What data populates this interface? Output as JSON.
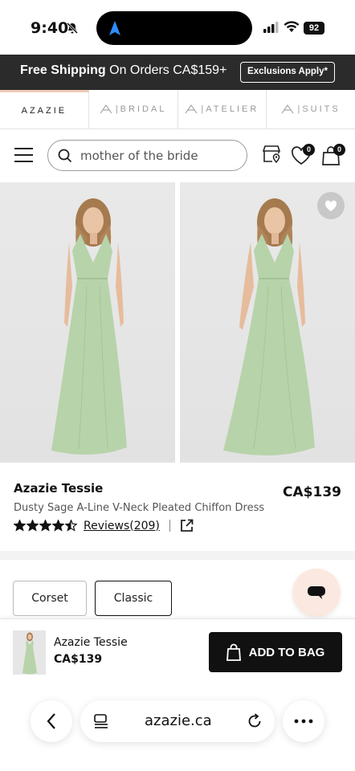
{
  "status_bar": {
    "time": "9:40",
    "battery": "92"
  },
  "promo": {
    "bold": "Free Shipping",
    "rest": " On Orders CA$159+",
    "exclusions_label": "Exclusions Apply*"
  },
  "brand_tabs": [
    {
      "label": "AZAZIE"
    },
    {
      "label": "BRIDAL"
    },
    {
      "label": "ATELIER"
    },
    {
      "label": "SUITS"
    }
  ],
  "header": {
    "search_value": "mother of the bride",
    "wishlist_count": "0",
    "cart_count": "0"
  },
  "product": {
    "name": "Azazie Tessie",
    "price": "CA$139",
    "description": "Dusty Sage A-Line V-Neck Pleated Chiffon Dress",
    "rating": 4.5,
    "reviews_label": "Reviews(209)",
    "dress_color": "#b7d3aa"
  },
  "styles": {
    "option1": "Corset",
    "option2": "Classic"
  },
  "sticky": {
    "name": "Azazie Tessie",
    "price": "CA$139",
    "add_label": "ADD TO BAG"
  },
  "browser": {
    "url": "azazie.ca"
  },
  "colors": {
    "dark": "#2b2b2b",
    "accent_peach": "#f0c9b8",
    "chat_bg": "#fbe9e1"
  }
}
